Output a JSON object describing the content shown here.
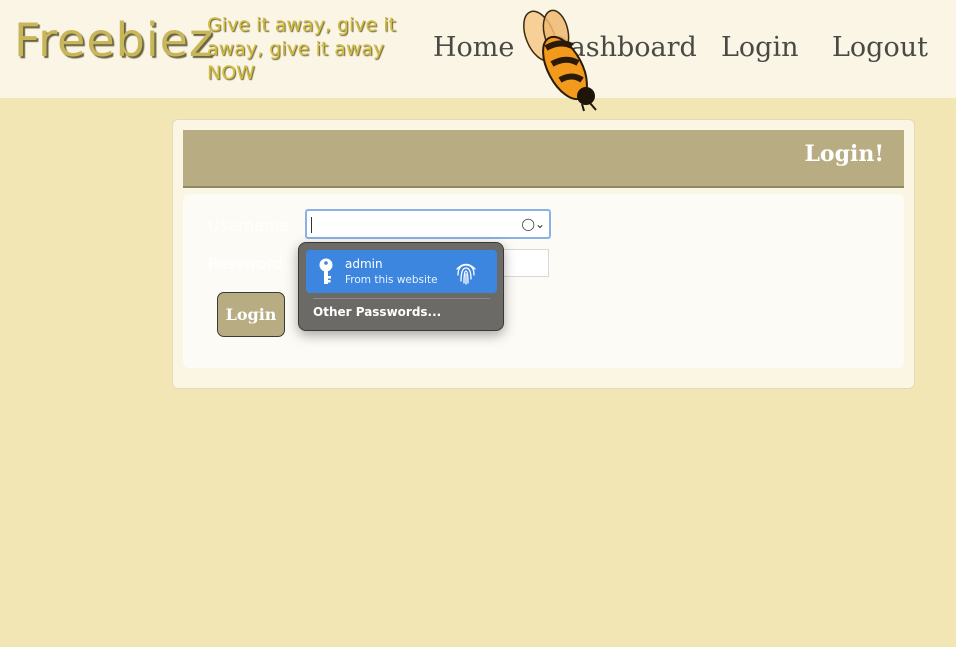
{
  "header": {
    "brand": "Freebiez",
    "tagline": "Give it away, give it away, give it away NOW",
    "nav": {
      "home": "Home",
      "dashboard": "Dashboard",
      "login": "Login",
      "logout": "Logout"
    }
  },
  "card": {
    "title": "Login!",
    "username_label": "Username",
    "password_label": "Password",
    "username_value": "",
    "password_value": "",
    "login_button": "Login"
  },
  "autofill": {
    "suggestion_user": "admin",
    "suggestion_source": "From this website",
    "other_passwords": "Other Passwords..."
  },
  "colors": {
    "page_background": "#f3e6b5",
    "header_background": "#faf5e4",
    "accent": "#b8ad82",
    "autofill_highlight": "#3d86e0"
  },
  "icons": [
    "bee-mascot-icon",
    "key-icon",
    "fingerprint-icon",
    "keychain-icon",
    "chevron-down-icon"
  ]
}
